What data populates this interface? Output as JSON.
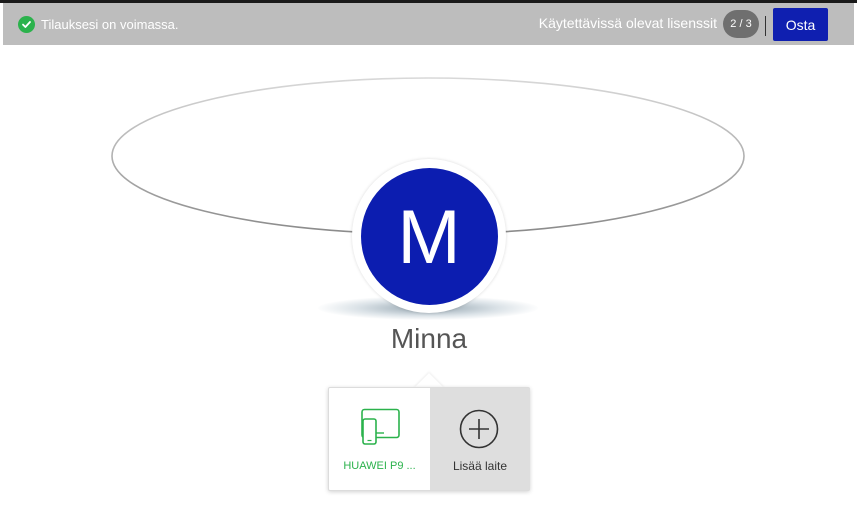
{
  "status_bar": {
    "subscription_status": "Tilauksesi on voimassa.",
    "licenses_label": "Käytettävissä olevat lisenssit",
    "license_count": "2 / 3",
    "buy_label": "Osta"
  },
  "user": {
    "initial": "M",
    "name": "Minna"
  },
  "devices": {
    "device_name": "HUAWEI P9 ...",
    "add_device_label": "Lisää laite"
  },
  "colors": {
    "accent_blue": "#0c1db0",
    "success_green": "#2bb24c",
    "status_bar_gray": "#bdbdbd"
  }
}
